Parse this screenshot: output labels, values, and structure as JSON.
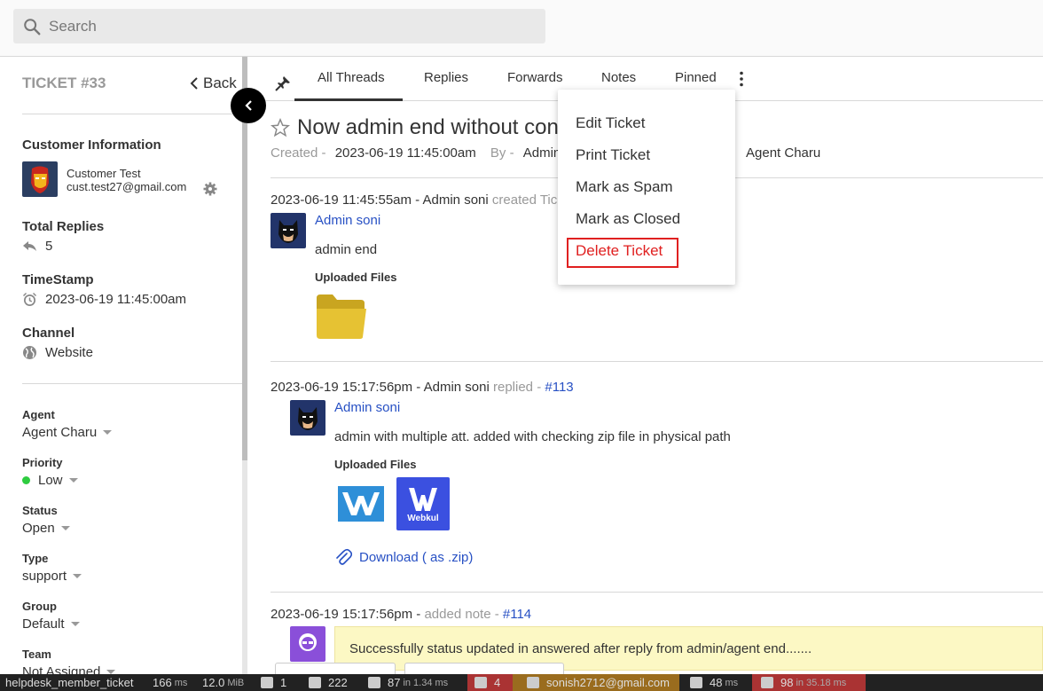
{
  "search": {
    "placeholder": "Search"
  },
  "sidebar": {
    "ticket_label": "TICKET #33",
    "back_label": "Back",
    "customer_heading": "Customer Information",
    "customer_name": "Customer Test",
    "customer_email": "cust.test27@gmail.com",
    "total_replies_heading": "Total Replies",
    "total_replies": "5",
    "timestamp_heading": "TimeStamp",
    "timestamp": "2023-06-19 11:45:00am",
    "channel_heading": "Channel",
    "channel": "Website",
    "fields": {
      "agent_label": "Agent",
      "agent_value": "Agent Charu",
      "priority_label": "Priority",
      "priority_value": "Low",
      "priority_color": "#2ecc40",
      "status_label": "Status",
      "status_value": "Open",
      "type_label": "Type",
      "type_value": "support",
      "group_label": "Group",
      "group_value": "Default",
      "team_label": "Team",
      "team_value": "Not Assigned"
    }
  },
  "tabs": {
    "all_threads": "All Threads",
    "replies": "Replies",
    "forwards": "Forwards",
    "notes": "Notes",
    "pinned": "Pinned"
  },
  "ticket": {
    "title": "Now admin end without con",
    "created_label": "Created -",
    "created_value": "2023-06-19 11:45:00am",
    "by_label": "By -",
    "by_value": "Admin",
    "agent_value": "Agent Charu"
  },
  "threads": [
    {
      "timestamp": "2023-06-19 11:45:55am - Admin soni",
      "action": "created Tic",
      "author": "Admin soni",
      "message": "admin end",
      "uploaded_label": "Uploaded Files"
    },
    {
      "timestamp": "2023-06-19 15:17:56pm - Admin soni",
      "action": "replied -",
      "ref": "#113",
      "author": "Admin soni",
      "message": "admin with multiple att. added with checking zip file in physical path",
      "uploaded_label": "Uploaded Files",
      "attachment_label": "Webkul",
      "download_label": "Download ( as .zip)"
    },
    {
      "timestamp": "2023-06-19 15:17:56pm -",
      "action": "added note -",
      "ref": "#114",
      "message": "Successfully status updated in answered after reply from admin/agent end......."
    }
  ],
  "menu": {
    "edit": "Edit Ticket",
    "print": "Print Ticket",
    "spam": "Mark as Spam",
    "closed": "Mark as Closed",
    "delete": "Delete Ticket",
    "danger_color": "#e02020"
  },
  "toolbar": {
    "route": "helpdesk_member_ticket",
    "time": "166",
    "time_unit": "ms",
    "memory": "12.0",
    "memory_unit": "MiB",
    "forms": "1",
    "warnings": "222",
    "cache": "87",
    "cache_in": "in",
    "cache_time": "1.34 ms",
    "translations": "4",
    "user": "sonish2712@gmail.com",
    "twig_time": "48",
    "twig_unit": "ms",
    "db_queries": "98",
    "db_in": "in",
    "db_time": "35.18 ms"
  }
}
